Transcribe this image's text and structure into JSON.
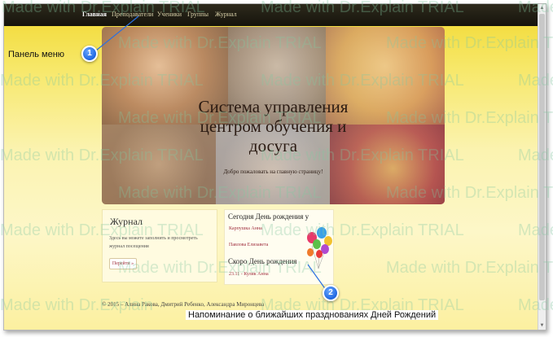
{
  "menu": {
    "items": [
      {
        "label": "Главная",
        "active": true
      },
      {
        "label": "Преподаватели",
        "active": false
      },
      {
        "label": "Ученики",
        "active": false
      },
      {
        "label": "Группы",
        "active": false
      },
      {
        "label": "Журнал",
        "active": false
      }
    ]
  },
  "hero": {
    "title_line1": "Система управления",
    "title_line2": "центром обучения и",
    "title_line3": "досуга",
    "subtitle": "Добро пожаловать на главную страницу!"
  },
  "journal": {
    "title": "Журнал",
    "description": "Здесь вы можете заполнить и просмотреть журнал посещения",
    "button_label": "Перейти »"
  },
  "birthdays": {
    "today_title": "Сегодня День рождения у",
    "today_list": [
      "Карпушка Анна",
      "Павлова Елизавета"
    ],
    "soon_title": "Скоро День рождения",
    "soon_list": [
      "23.11 - Кулик Анна"
    ]
  },
  "footer": {
    "text": "© 2015 – Алина Ракова, Дмитрий Ребенко, Александра Миронцева"
  },
  "callouts": {
    "c1": {
      "number": "1",
      "text": "Панель меню"
    },
    "c2": {
      "number": "2",
      "text": "Напоминание о ближайших празднованиях Дней Рождений"
    }
  },
  "watermark": {
    "text": "Made with Dr.Explain TRIAL",
    "text_short": "Made with Dr.Explain"
  },
  "colors": {
    "menu_bg": "#1f1c12",
    "page_gradient_top": "#f1d82f",
    "page_gradient_bottom": "#fdf7c8",
    "link": "#a03040",
    "badge": "#1e66e0"
  }
}
